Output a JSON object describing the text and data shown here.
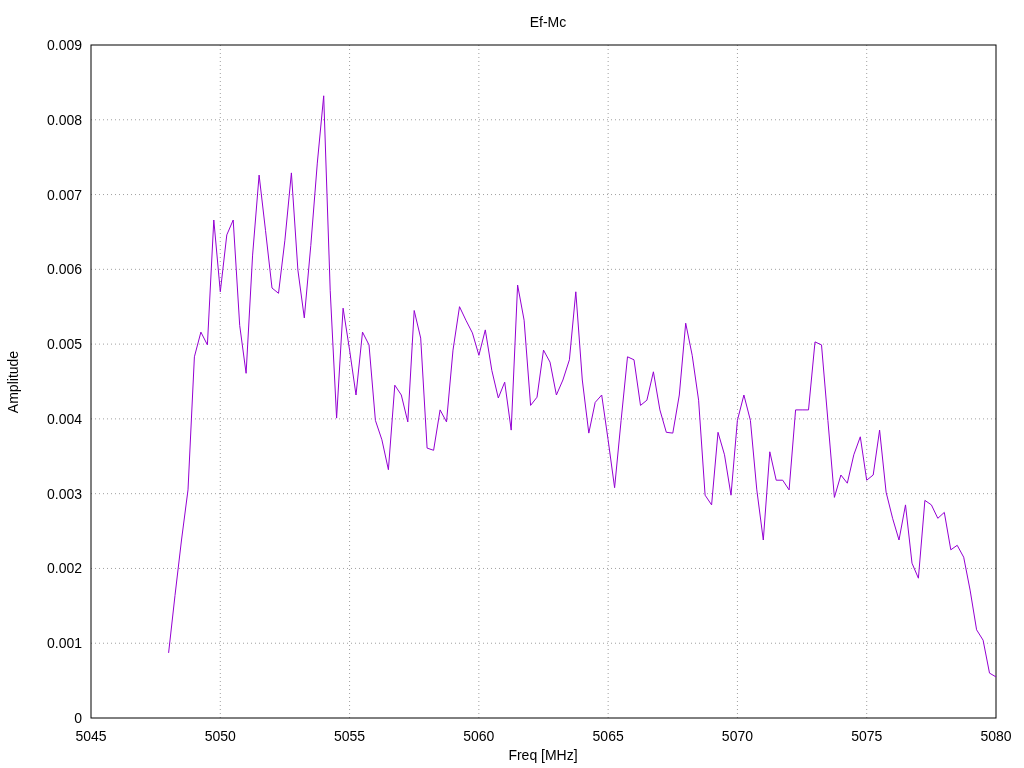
{
  "chart_data": {
    "type": "line",
    "title": "Ef-Mc",
    "xlabel": "Freq [MHz]",
    "ylabel": "Amplitude",
    "grid": true,
    "xlim": [
      5045,
      5080
    ],
    "ylim": [
      0,
      0.009
    ],
    "xticks": [
      5045,
      5050,
      5055,
      5060,
      5065,
      5070,
      5075,
      5080
    ],
    "yticks": [
      0,
      0.001,
      0.002,
      0.003,
      0.004,
      0.005,
      0.006,
      0.007,
      0.008,
      0.009
    ],
    "x": [
      5048,
      5048.25,
      5048.5,
      5048.75,
      5049,
      5049.25,
      5049.5,
      5049.75,
      5050,
      5050.25,
      5050.5,
      5050.75,
      5051,
      5051.25,
      5051.5,
      5051.75,
      5052,
      5052.25,
      5052.5,
      5052.75,
      5053,
      5053.25,
      5053.5,
      5053.75,
      5054,
      5054.25,
      5054.5,
      5054.75,
      5055,
      5055.25,
      5055.5,
      5055.75,
      5056,
      5056.25,
      5056.5,
      5056.75,
      5057,
      5057.25,
      5057.5,
      5057.75,
      5058,
      5058.25,
      5058.5,
      5058.75,
      5059,
      5059.25,
      5059.5,
      5059.75,
      5060,
      5060.25,
      5060.5,
      5060.75,
      5061,
      5061.25,
      5061.5,
      5061.75,
      5062,
      5062.25,
      5062.5,
      5062.75,
      5063,
      5063.25,
      5063.5,
      5063.75,
      5064,
      5064.25,
      5064.5,
      5064.75,
      5065,
      5065.25,
      5065.5,
      5065.75,
      5066,
      5066.25,
      5066.5,
      5066.75,
      5067,
      5067.25,
      5067.5,
      5067.75,
      5068,
      5068.25,
      5068.5,
      5068.75,
      5069,
      5069.25,
      5069.5,
      5069.75,
      5070,
      5070.25,
      5070.5,
      5070.75,
      5071,
      5071.25,
      5071.5,
      5071.75,
      5072,
      5072.25,
      5072.5,
      5072.75,
      5073,
      5073.25,
      5073.5,
      5073.75,
      5074,
      5074.25,
      5074.5,
      5074.75,
      5075,
      5075.25,
      5075.5,
      5075.75,
      5076,
      5076.25,
      5076.5,
      5076.75,
      5077,
      5077.25,
      5077.5,
      5077.75,
      5078,
      5078.25,
      5078.5,
      5078.75,
      5079,
      5079.25,
      5079.5,
      5079.75,
      5080
    ],
    "series": [
      {
        "color": "#9400d3",
        "values": [
          0.00087,
          0.00164,
          0.00238,
          0.00305,
          0.00483,
          0.00516,
          0.00499,
          0.00666,
          0.0057,
          0.00646,
          0.00666,
          0.00525,
          0.00461,
          0.00619,
          0.00726,
          0.00652,
          0.00575,
          0.00568,
          0.00639,
          0.00729,
          0.00599,
          0.00535,
          0.00632,
          0.00742,
          0.00832,
          0.00572,
          0.00401,
          0.00548,
          0.00492,
          0.00432,
          0.00516,
          0.00499,
          0.00398,
          0.00372,
          0.00332,
          0.00445,
          0.00432,
          0.00396,
          0.00545,
          0.00508,
          0.00361,
          0.00358,
          0.00412,
          0.00396,
          0.00492,
          0.0055,
          0.00532,
          0.00515,
          0.00485,
          0.00519,
          0.00465,
          0.00428,
          0.00449,
          0.00385,
          0.00579,
          0.00532,
          0.00418,
          0.00429,
          0.00492,
          0.00476,
          0.00432,
          0.00452,
          0.00479,
          0.0057,
          0.00452,
          0.00381,
          0.00422,
          0.00432,
          0.00372,
          0.00308,
          0.00398,
          0.00483,
          0.00479,
          0.00418,
          0.00425,
          0.00463,
          0.00412,
          0.00382,
          0.00381,
          0.00432,
          0.00528,
          0.00485,
          0.00425,
          0.00298,
          0.00285,
          0.00382,
          0.00352,
          0.00298,
          0.00398,
          0.00432,
          0.00398,
          0.00305,
          0.00238,
          0.00356,
          0.00318,
          0.00318,
          0.00305,
          0.00412,
          0.00412,
          0.00412,
          0.00503,
          0.00499,
          0.00398,
          0.00295,
          0.00325,
          0.00314,
          0.00352,
          0.00376,
          0.00318,
          0.00325,
          0.00385,
          0.00302,
          0.00267,
          0.00238,
          0.00285,
          0.00207,
          0.00187,
          0.00291,
          0.00285,
          0.00267,
          0.00275,
          0.00225,
          0.00231,
          0.00215,
          0.00171,
          0.00118,
          0.00104,
          0.0006,
          0.00055
        ]
      }
    ]
  }
}
